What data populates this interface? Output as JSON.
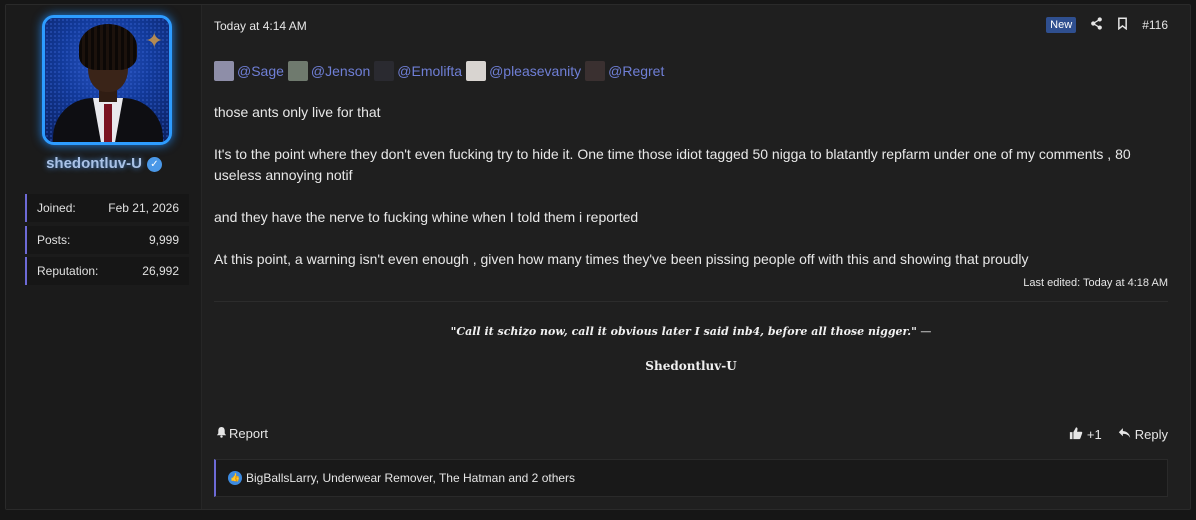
{
  "user": {
    "name": "shedontluv-U",
    "stats": [
      {
        "label": "Joined:",
        "value": "Feb 21, 2026"
      },
      {
        "label": "Posts:",
        "value": "9,999"
      },
      {
        "label": "Reputation:",
        "value": "26,992"
      }
    ]
  },
  "post": {
    "time": "Today at 4:14 AM",
    "badge": "New",
    "number": "#116",
    "mentions": [
      "@Sage",
      "@Jenson",
      "@Emolifta",
      "@pleasevanity",
      "@Regret"
    ],
    "paragraphs": [
      "those ants only live for that",
      "It's to the point where they don't even fucking try to hide it. One time those idiot tagged 50 nigga to blatantly repfarm under one of my comments , 80 useless annoying notif",
      "and they have the nerve to fucking whine when I told them i reported",
      "At this point, a warning isn't even enough , given how many times they've been pissing people off with this and showing that proudly"
    ],
    "edited": "Last edited: Today at 4:18 AM",
    "signature": {
      "quote": "\"Call it schizo now, call it obvious later I said inb4, before all those nigger.\"",
      "dash": " —",
      "name": "Shedontluv-U"
    },
    "report_label": "Report",
    "like_count": "+1",
    "reply_label": "Reply",
    "reactions_text": "BigBallsLarry, Underwear Remover, The Hatman and 2 others"
  },
  "colors": {
    "accent": "#6d6ad6",
    "mention": "#6f7fd6",
    "badge": "#2f4f8f"
  }
}
